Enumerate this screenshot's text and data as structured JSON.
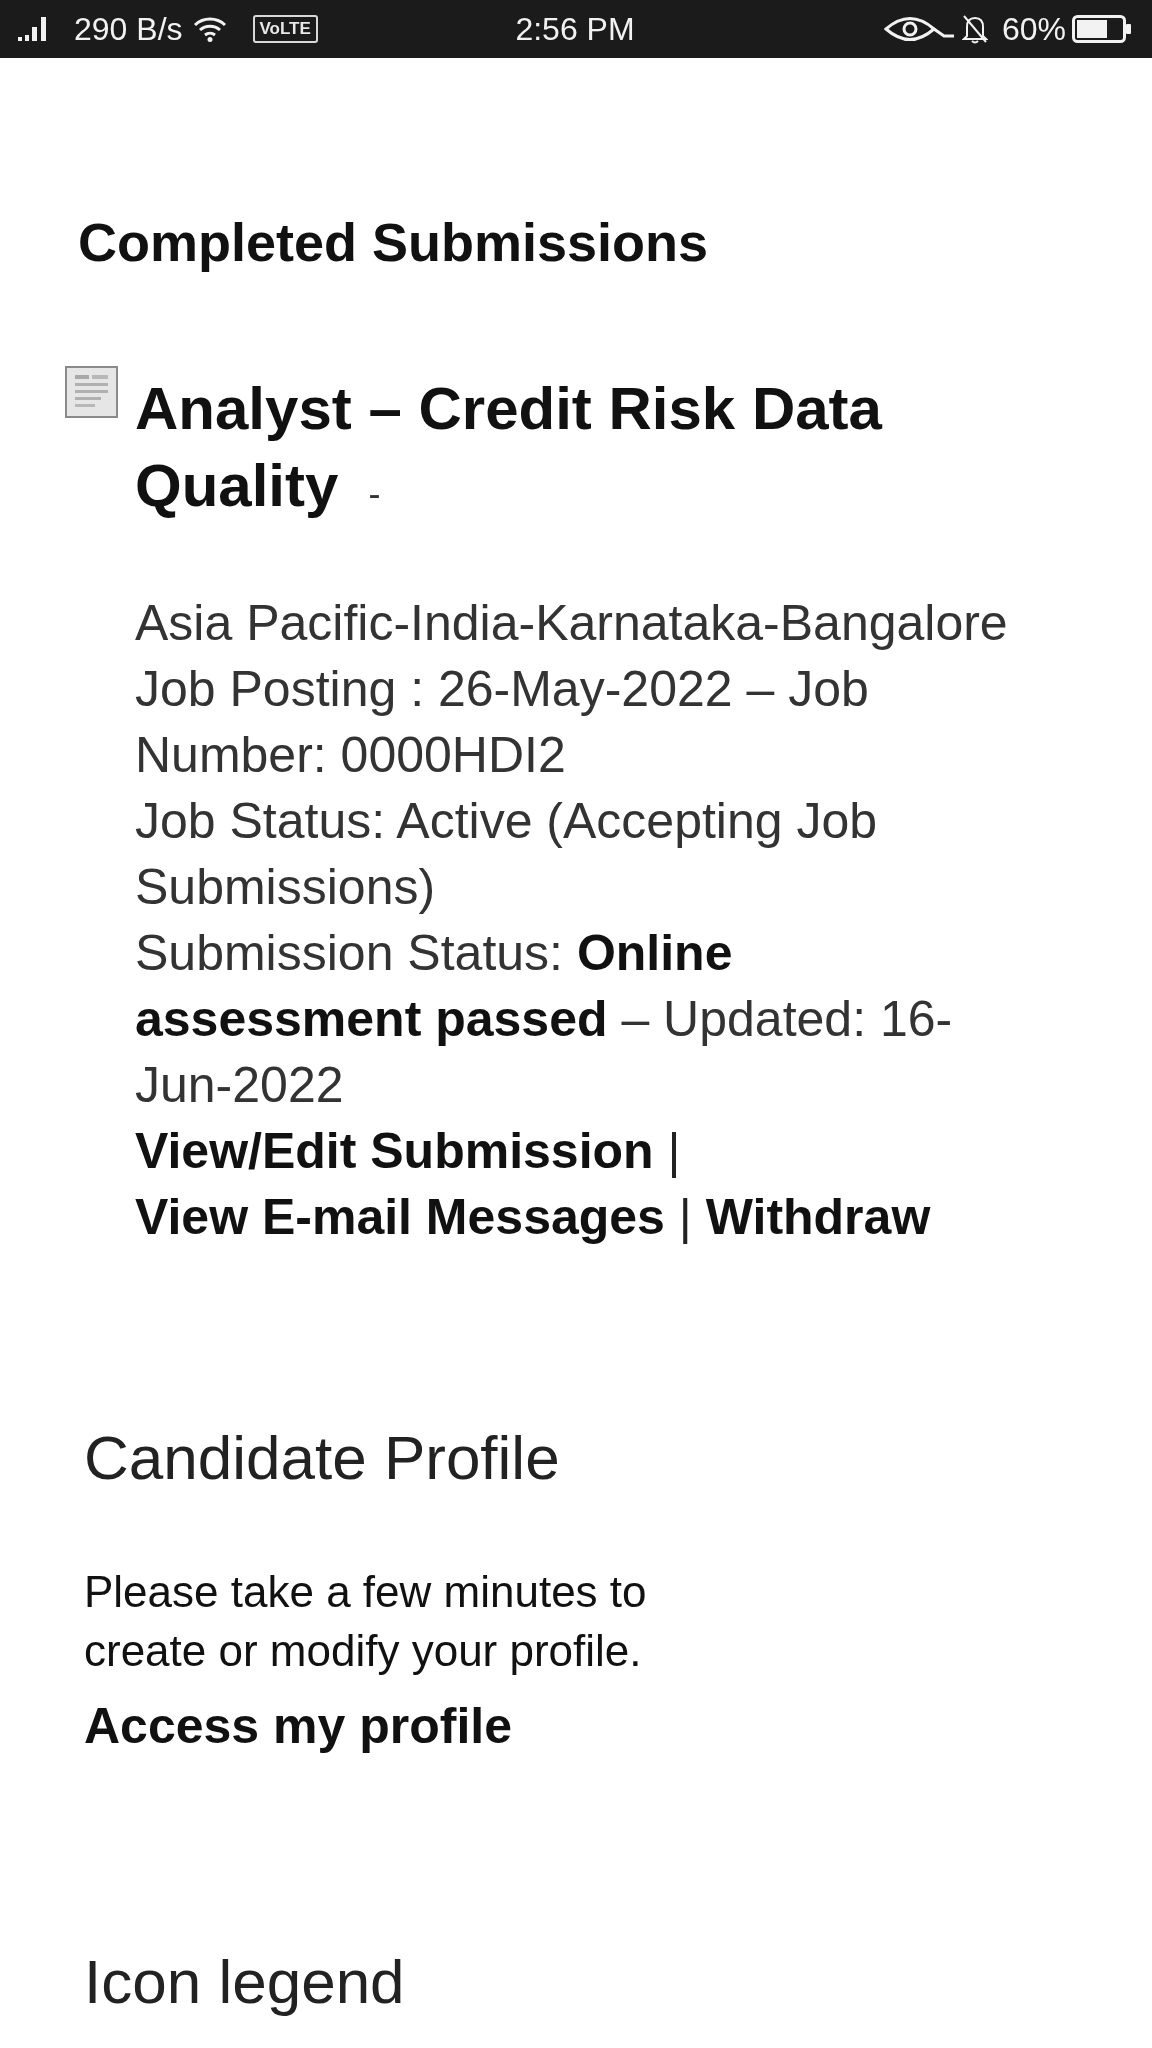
{
  "status_bar": {
    "network_speed": "290 B/s",
    "network_badge": "VoLTE",
    "time": "2:56 PM",
    "battery": "60%"
  },
  "completed_submissions": {
    "title": "Completed Submissions",
    "items": [
      {
        "title": "Analyst – Credit Risk Data Quality",
        "title_suffix": "-",
        "location": "Asia Pacific-India-Karnataka-Bangalore",
        "job_posting": "Job Posting : 26-May-2022 – Job Number: 0000HDI2",
        "job_status": "Job Status: Active (Accepting Job Submissions)",
        "submission_status": "Submission Status: **Online assessment passed** – Updated: 16-Jun-2022",
        "links": [
          {
            "label": "View/Edit Submission"
          },
          {
            "label": "View E-mail Messages"
          },
          {
            "label": "Withdraw"
          }
        ],
        "separators": [
          "|",
          "|"
        ]
      }
    ]
  },
  "candidate_profile": {
    "title": "Candidate Profile",
    "text": "Please take a few minutes to create or modify your profile.",
    "link": "Access my profile"
  },
  "icon_legend": {
    "title": "Icon legend"
  }
}
